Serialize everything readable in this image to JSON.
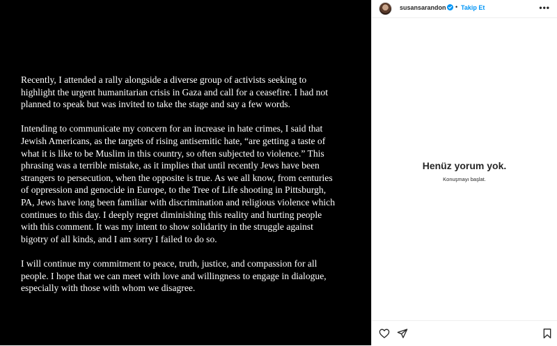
{
  "post": {
    "paragraphs": [
      [
        "Recently, I attended a rally alongside a diverse group of activists seeking to",
        "highlight the urgent humanitarian crisis in Gaza and call for a ceasefire. I had not",
        "planned to speak but was invited to take the stage and say a few words."
      ],
      [
        "Intending to communicate my concern for an increase in hate crimes, I said that",
        "Jewish Americans, as the targets of rising antisemitic hate, “are getting a taste of",
        "what it is like to be Muslim in this country, so often subjected to violence.” This",
        "phrasing was a terrible mistake, as it implies that until recently Jews have been",
        "strangers to persecution, when the opposite is true. As we all know, from centuries",
        "of oppression and genocide in Europe, to the Tree of Life shooting in Pittsburgh,",
        "PA, Jews have long been familiar with discrimination and religious violence which",
        "continues to this day. I deeply regret diminishing this reality and hurting people",
        "with this comment. It was my intent to show solidarity in the struggle against",
        "bigotry of all kinds, and I am sorry I failed to do so."
      ],
      [
        "I will continue my commitment to peace, truth, justice, and compassion for all",
        "people. I hope that we can meet with love and willingness to engage in dialogue,",
        "especially with those with whom we disagree."
      ]
    ]
  },
  "header": {
    "username": "susansarandon",
    "separator": "•",
    "follow_label": "Takip Et",
    "more_label": "•••"
  },
  "comments": {
    "empty_title": "Henüz yorum yok.",
    "empty_subtitle": "Konuşmayı başlat."
  },
  "colors": {
    "accent": "#0095f6",
    "text": "#262626",
    "media_bg": "#000000"
  },
  "icons": {
    "like": "heart-icon",
    "share": "paper-plane-icon",
    "save": "bookmark-icon",
    "verified": "verified-badge-icon"
  }
}
